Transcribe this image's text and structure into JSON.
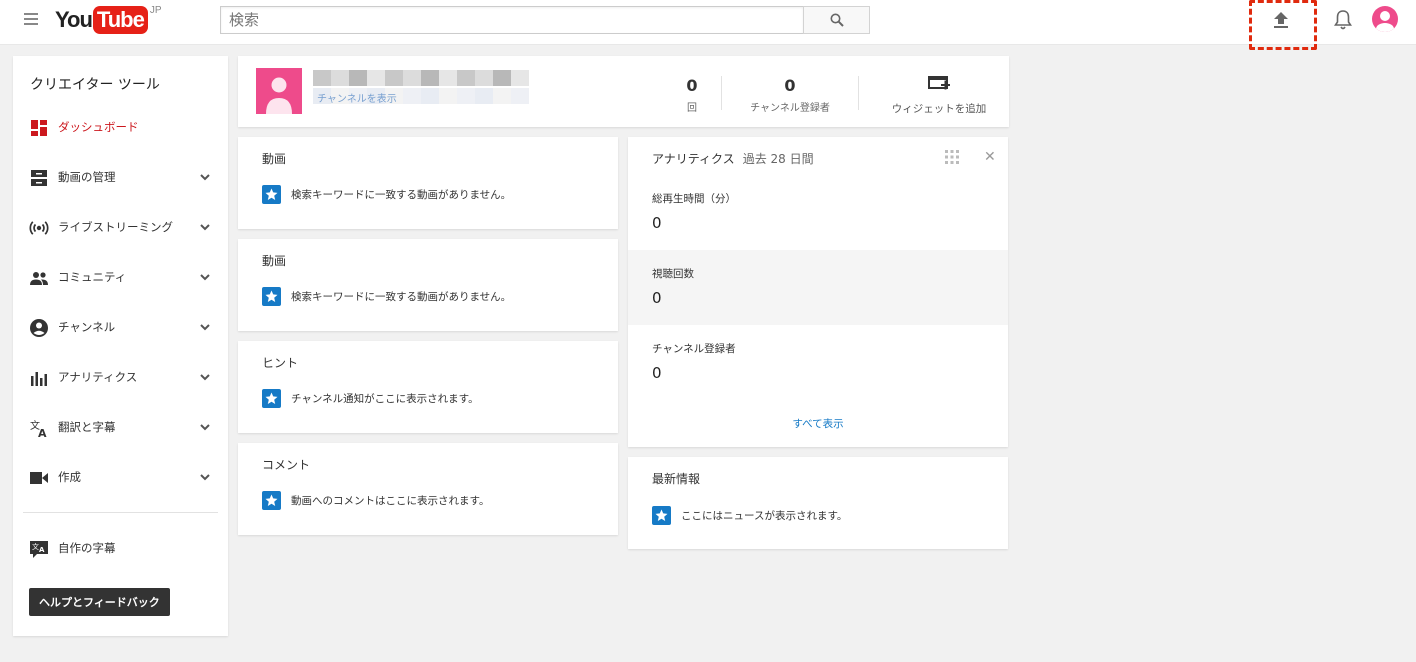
{
  "masthead": {
    "logo_you": "You",
    "logo_tube": "Tube",
    "logo_region": "JP",
    "search_placeholder": "検索"
  },
  "sidebar": {
    "title": "クリエイター ツール",
    "items": [
      {
        "label": "ダッシュボード",
        "icon": "dashboard-icon",
        "active": true
      },
      {
        "label": "動画の管理",
        "icon": "video-manager-icon"
      },
      {
        "label": "ライブストリーミング",
        "icon": "live-streaming-icon"
      },
      {
        "label": "コミュニティ",
        "icon": "community-icon"
      },
      {
        "label": "チャンネル",
        "icon": "channel-icon"
      },
      {
        "label": "アナリティクス",
        "icon": "analytics-icon"
      },
      {
        "label": "翻訳と字幕",
        "icon": "translate-icon"
      },
      {
        "label": "作成",
        "icon": "create-icon"
      }
    ],
    "subtitles_label": "自作の字幕",
    "help_label": "ヘルプとフィードバック"
  },
  "channel": {
    "link_text": "チャンネルを表示",
    "views_value": "0",
    "views_label": "回",
    "subscribers_value": "0",
    "subscribers_label": "チャンネル登録者",
    "add_widget_label": "ウィジェットを追加"
  },
  "widgets": [
    {
      "title": "動画",
      "message": "検索キーワードに一致する動画がありません。"
    },
    {
      "title": "動画",
      "message": "検索キーワードに一致する動画がありません。"
    },
    {
      "title": "ヒント",
      "message": "チャンネル通知がここに表示されます。"
    },
    {
      "title": "コメント",
      "message": "動画へのコメントはここに表示されます。"
    }
  ],
  "analytics": {
    "title": "アナリティクス",
    "period": "過去 28 日間",
    "metrics": [
      {
        "label": "総再生時間（分）",
        "value": "0"
      },
      {
        "label": "視聴回数",
        "value": "0"
      },
      {
        "label": "チャンネル登録者",
        "value": "0"
      }
    ],
    "show_all": "すべて表示"
  },
  "news": {
    "title": "最新情報",
    "message": "ここにはニュースが表示されます。"
  },
  "colors": {
    "brand_red": "#e62117",
    "active_red": "#cc181e",
    "link_blue": "#167ac6",
    "highlight": "#e02a0e"
  }
}
